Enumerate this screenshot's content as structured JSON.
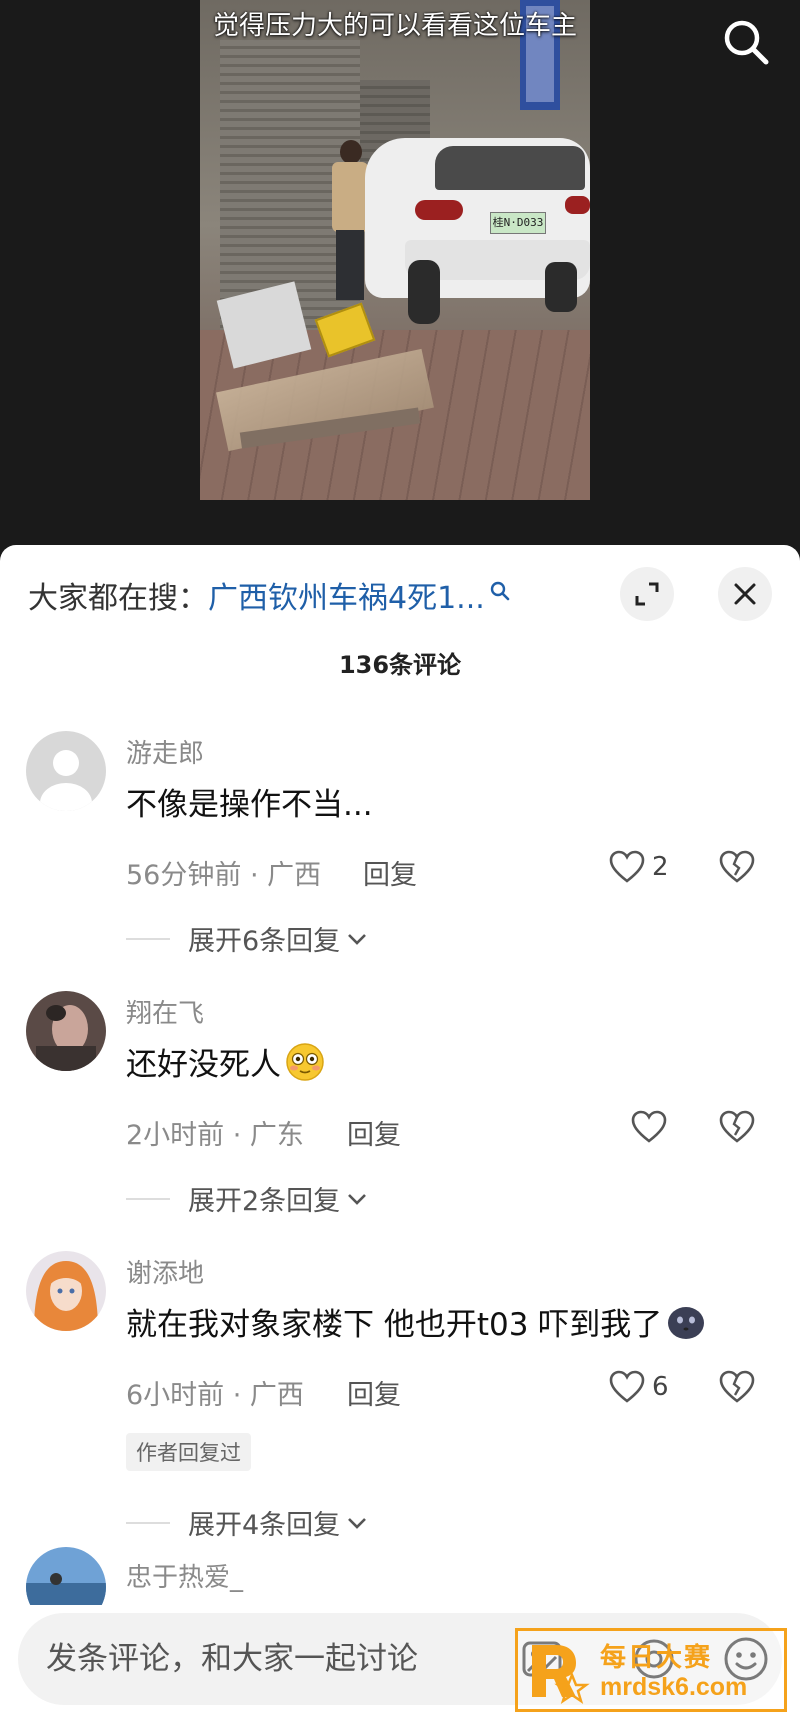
{
  "video": {
    "caption": "觉得压力大的可以看看这位车主",
    "plate": "桂N·D033"
  },
  "hot_search": {
    "prefix": "大家都在搜：",
    "query": "广西钦州车祸4死1..."
  },
  "comment_count": "136条评论",
  "comments": [
    {
      "username": "游走郎",
      "text": "不像是操作不当...",
      "time_location": "56分钟前 · 广西",
      "reply_label": "回复",
      "likes": "2",
      "expand_label": "展开6条回复"
    },
    {
      "username": "翔在飞",
      "text": "还好没死人",
      "emoji": "flushed-face",
      "time_location": "2小时前 · 广东",
      "reply_label": "回复",
      "likes": "",
      "expand_label": "展开2条回复"
    },
    {
      "username": "谢添地",
      "text": "就在我对象家楼下 他也开t03 吓到我了",
      "emoji": "dark-blob-face",
      "time_location": "6小时前 · 广西",
      "reply_label": "回复",
      "likes": "6",
      "author_badge": "作者回复过",
      "expand_label": "展开4条回复"
    },
    {
      "username": "忠于热爱_"
    }
  ],
  "input": {
    "placeholder": "发条评论，和大家一起讨论"
  },
  "watermark": {
    "title": "每日大赛",
    "url": "mrdsk6.com"
  },
  "colors": {
    "link": "#1f5fa8",
    "watermark": "#f5a21b"
  }
}
